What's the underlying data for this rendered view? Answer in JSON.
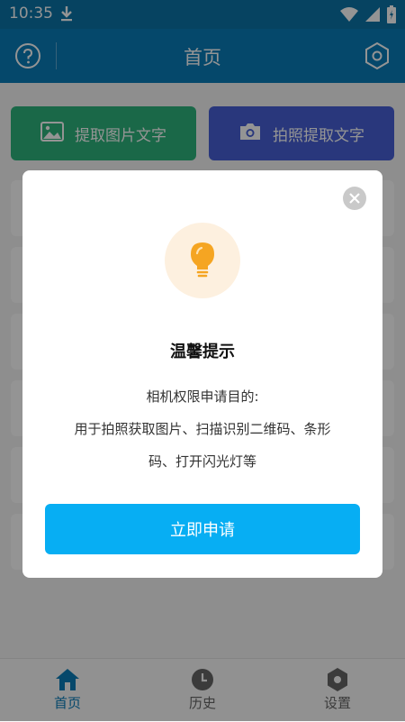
{
  "status_bar": {
    "time": "10:35"
  },
  "header": {
    "title": "首页"
  },
  "actions": {
    "extract_image_text": "提取图片文字",
    "camera_extract_text": "拍照提取文字"
  },
  "bottom_nav": {
    "home": "首页",
    "history": "历史",
    "settings": "设置"
  },
  "dialog": {
    "title": "温馨提示",
    "line1": "相机权限申请目的:",
    "line2": "用于拍照获取图片、扫描识别二维码、条形",
    "line3": "码、打开闪光灯等",
    "button": "立即申请"
  },
  "colors": {
    "header": "#0a7cb8",
    "green_button": "#2db47c",
    "blue_button": "#4760d6",
    "cta": "#07aef3",
    "bulb": "#f5a522"
  }
}
